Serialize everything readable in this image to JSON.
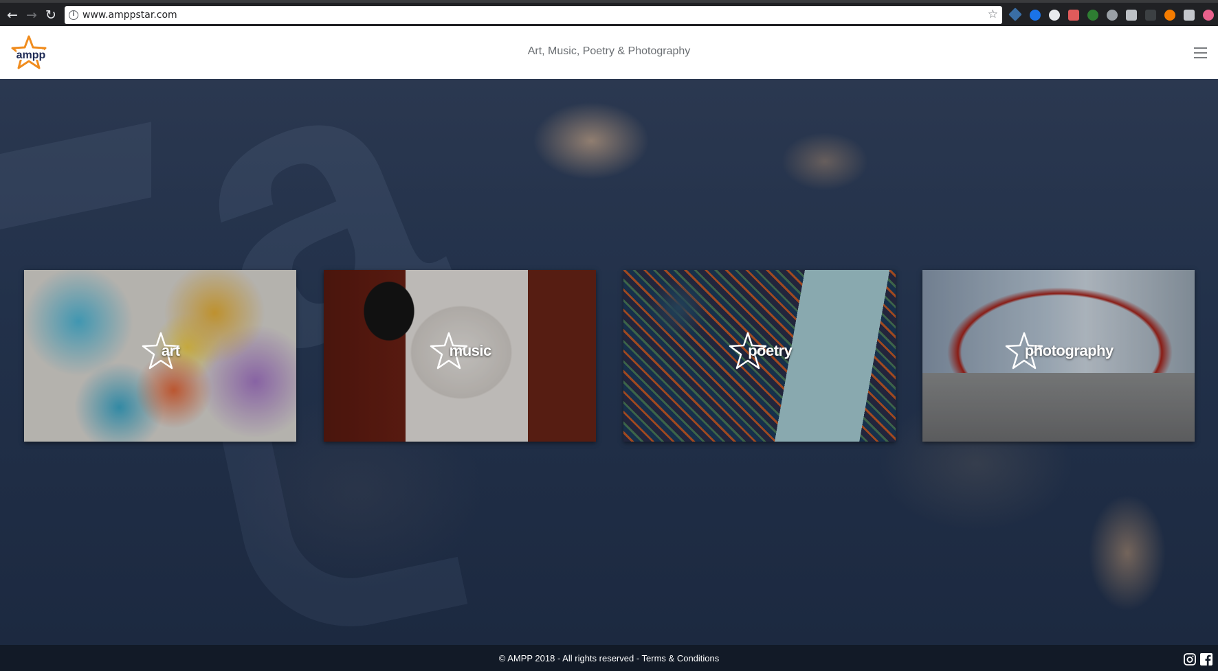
{
  "browser": {
    "url": "www.amppstar.com",
    "back_glyph": "←",
    "forward_glyph": "→",
    "reload_glyph": "↻",
    "bookmark_glyph": "☆",
    "info_glyph": "i"
  },
  "header": {
    "logo_text": "ampp",
    "tagline": "Art, Music, Poetry & Photography"
  },
  "categories": [
    {
      "label": "art"
    },
    {
      "label": "music"
    },
    {
      "label": "poetry"
    },
    {
      "label": "photography"
    }
  ],
  "footer": {
    "copyright": "© AMPP 2018 - All rights reserved - ",
    "terms": "Terms & Conditions"
  },
  "colors": {
    "brand_orange": "#f08c1e",
    "brand_navy": "#1f2b55",
    "footer_bg": "#121a27"
  },
  "icons": [
    "instagram-icon",
    "facebook-icon",
    "menu-icon",
    "star-icon"
  ]
}
